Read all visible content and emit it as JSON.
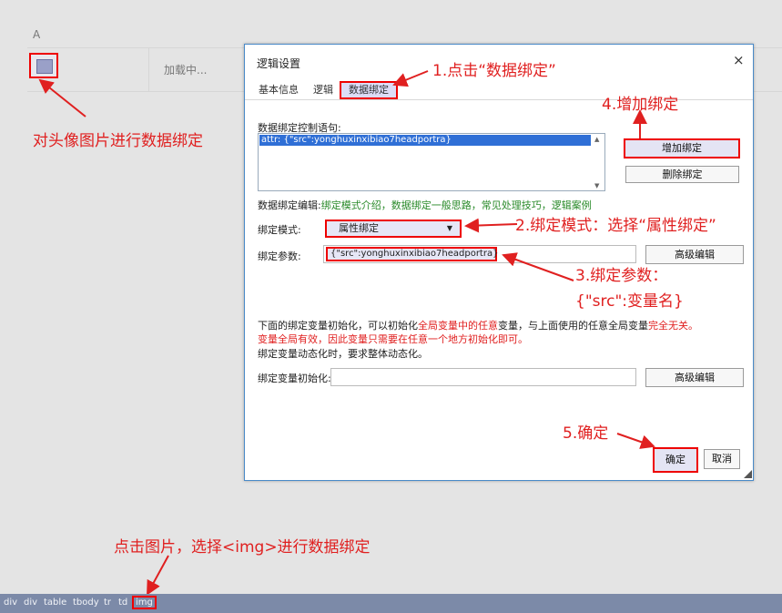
{
  "background": {
    "column_header": "A",
    "loading_text": "加载中...",
    "avatar_alt": "image-icon"
  },
  "dialog": {
    "title": "逻辑设置",
    "close": "×",
    "tabs": [
      {
        "label": "基本信息",
        "active": false
      },
      {
        "label": "逻辑",
        "active": false
      },
      {
        "label": "数据绑定",
        "active": true
      }
    ],
    "binding_stmt_label": "数据绑定控制语句:",
    "binding_stmt_line": "attr: {\"src\":yonghuxinxibiao7headportra}",
    "add_binding": "增加绑定",
    "delete_binding": "删除绑定",
    "edit_label": "数据绑定编辑:",
    "edit_links": [
      "绑定模式介绍",
      "数据绑定一般思路",
      "常见处理技巧",
      "逻辑案例"
    ],
    "edit_sep": "，",
    "mode_label": "绑定模式:",
    "mode_value": "属性绑定",
    "param_label": "绑定参数:",
    "param_value": "{\"src\":yonghuxinxibiao7headportra}",
    "advanced_edit": "高级编辑",
    "note1_a": "下面的绑定变量初始化，可以初始化",
    "note1_b": "全局变量中的任意",
    "note1_c": "变量，与上面使用的任意全局变量",
    "note1_d": "完全无关。",
    "note2": "变量全局有效，因此变量只需要在任意一个地方初始化即可。",
    "note3": "绑定变量动态化时，要求整体动态化。",
    "init_label": "绑定变量初始化:",
    "advanced_edit2": "高级编辑",
    "ok": "确定",
    "cancel": "取消"
  },
  "annotations": {
    "step1": "1.点击“数据绑定”",
    "step2": "2.绑定模式：选择“属性绑定”",
    "step3_line1": "3.绑定参数：",
    "step3_line2": "{\"src\":变量名}",
    "step4": "4.增加绑定",
    "step5": "5.确定",
    "avatar_note": "对头像图片进行数据绑定",
    "bottom_note": "点击图片，选择<img>进行数据绑定"
  },
  "breadcrumb": [
    "div",
    "div",
    "table",
    "tbody",
    "tr",
    "td",
    "img"
  ],
  "colors": {
    "annotation_red": "#e02020",
    "dialog_border": "#4a8ac8",
    "selection_blue": "#2f6fd6",
    "link_green": "#2a8a2a",
    "breadcrumb_bar": "#7c8aa8"
  }
}
